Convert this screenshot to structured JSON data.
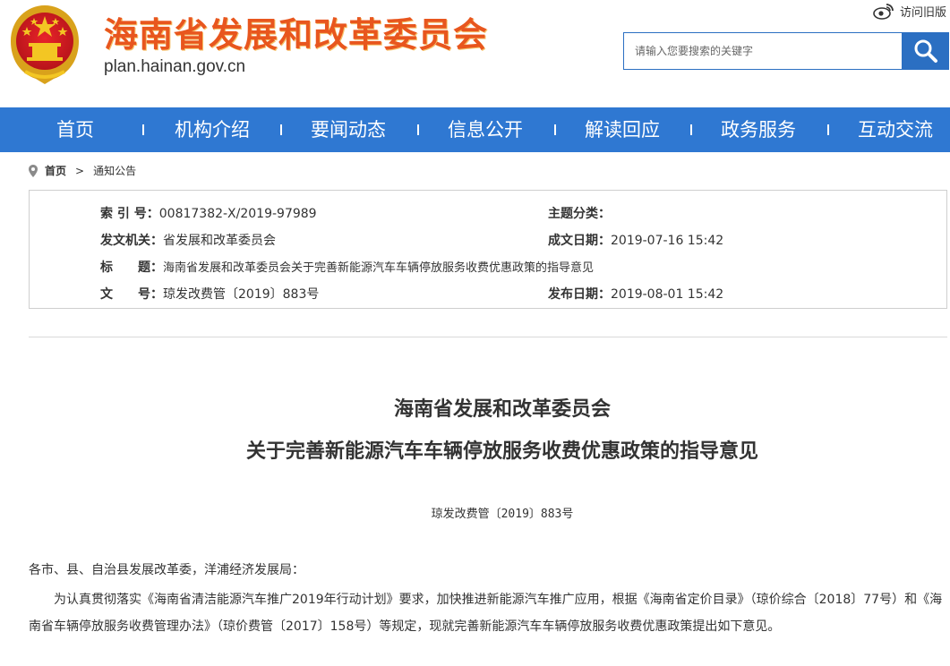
{
  "header": {
    "site_title": "海南省发展和改革委员会",
    "site_domain": "plan.hainan.gov.cn",
    "old_version_label": "访问旧版",
    "search_placeholder": "请输入您要搜索的关键字"
  },
  "nav": {
    "items": [
      "首页",
      "机构介绍",
      "要闻动态",
      "信息公开",
      "解读回应",
      "政务服务",
      "互动交流"
    ]
  },
  "breadcrumb": {
    "home": "首页",
    "current": "通知公告"
  },
  "meta": {
    "index_label": "索 引 号：",
    "index_value": "00817382-X/2019-97989",
    "topic_label": "主题分类：",
    "topic_value": "",
    "issuer_label": "发文机关：",
    "issuer_value": "省发展和改革委员会",
    "created_label": "成文日期：",
    "created_value": "2019-07-16 15:42",
    "title_label": "标　　题：",
    "title_value": "海南省发展和改革委员会关于完善新能源汽车车辆停放服务收费优惠政策的指导意见",
    "docno_label": "文　　号：",
    "docno_value": "琼发改费管〔2019〕883号",
    "published_label": "发布日期：",
    "published_value": "2019-08-01 15:42"
  },
  "article": {
    "title_line1": "海南省发展和改革委员会",
    "title_line2": "关于完善新能源汽车车辆停放服务收费优惠政策的指导意见",
    "doc_number": "琼发改费管〔2019〕883号",
    "salutation": "各市、县、自治县发展改革委，洋浦经济发展局：",
    "paragraph1": "为认真贯彻落实《海南省清洁能源汽车推广2019年行动计划》要求，加快推进新能源汽车推广应用，根据《海南省定价目录》（琼价综合〔2018〕77号）和《海南省车辆停放服务收费管理办法》（琼价费管〔2017〕158号）等规定，现就完善新能源汽车车辆停放服务收费优惠政策提出如下意见。"
  },
  "colors": {
    "nav_blue": "#2f78d2",
    "title_orange": "#e8561e",
    "search_blue": "#2b6fc2"
  }
}
